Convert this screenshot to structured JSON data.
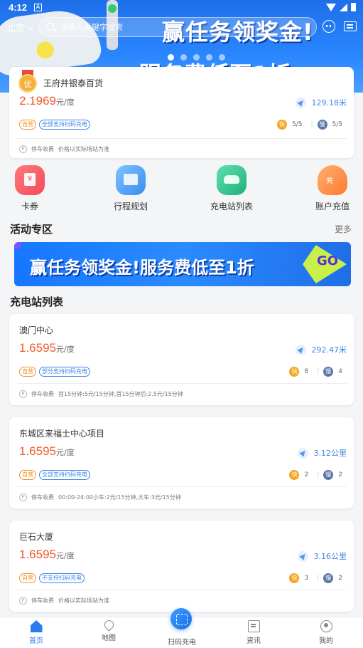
{
  "status": {
    "time": "4:12",
    "notif_letter": "A"
  },
  "header": {
    "city": "北京",
    "search_placeholder": "请输入关键字搜索",
    "banner_line1": "赢任务领奖金!",
    "banner_line2": "服务费低至1折"
  },
  "top_station": {
    "name": "王府井银泰百货",
    "badge": "优",
    "price": "2.1969",
    "unit": "元/度",
    "distance": "129.18米",
    "tags": [
      "自营",
      "全部支持扫码充电"
    ],
    "fast_count": "5/5",
    "slow_count": "5/5",
    "fast_label": "快",
    "slow_label": "慢",
    "parking": "停车收费",
    "parking_note": "价格以实际场站为准"
  },
  "quick_menu": [
    {
      "label": "卡券",
      "icon": "coupon-icon"
    },
    {
      "label": "行程规划",
      "icon": "trip-plan-icon"
    },
    {
      "label": "充电站列表",
      "icon": "station-list-icon"
    },
    {
      "label": "账户充值",
      "icon": "recharge-icon"
    }
  ],
  "activity": {
    "title": "活动专区",
    "more": "更多",
    "promo_text": "赢任务领奖金!服务费低至1折",
    "promo_go": "GO"
  },
  "station_list": {
    "title": "充电站列表",
    "items": [
      {
        "name": "澳门中心",
        "price": "1.6595",
        "unit": "元/度",
        "distance": "292.47米",
        "tags": [
          "自营",
          "部分支持扫码充电"
        ],
        "fast_count": "8",
        "slow_count": "4",
        "parking": "停车收费",
        "parking_note": "首15分钟:5元/15分钟,首15分钟后:2.5元/15分钟"
      },
      {
        "name": "东城区来福士中心项目",
        "price": "1.6595",
        "unit": "元/度",
        "distance": "3.12公里",
        "tags": [
          "自营",
          "全部支持扫码充电"
        ],
        "fast_count": "2",
        "slow_count": "2",
        "parking": "停车收费",
        "parking_note": "00:00-24:00小车:2元/15分钟,大车:3元/15分钟"
      },
      {
        "name": "巨石大厦",
        "price": "1.6595",
        "unit": "元/度",
        "distance": "3.16公里",
        "tags": [
          "自营",
          "不支持扫码充电"
        ],
        "fast_count": "3",
        "slow_count": "2",
        "parking": "停车收费",
        "parking_note": "价格以实际场站为准"
      }
    ]
  },
  "bottom_nav": {
    "home": "首页",
    "map": "地图",
    "scan": "扫码充电",
    "news": "资讯",
    "me": "我的"
  },
  "colors": {
    "accent": "#2a7cf0",
    "price": "#f05a28",
    "self_tag": "#f5902a",
    "banner": "#1e6fe8"
  }
}
